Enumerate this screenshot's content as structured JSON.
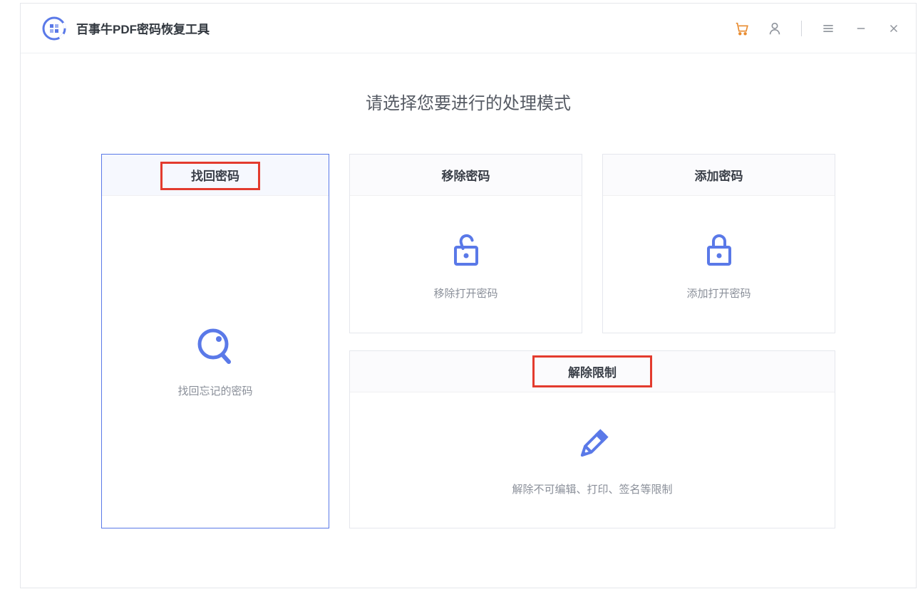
{
  "app": {
    "title": "百事牛PDF密码恢复工具"
  },
  "page": {
    "heading": "请选择您要进行的处理模式"
  },
  "cards": {
    "recover": {
      "title": "找回密码",
      "desc": "找回忘记的密码"
    },
    "remove": {
      "title": "移除密码",
      "desc": "移除打开密码"
    },
    "add": {
      "title": "添加密码",
      "desc": "添加打开密码"
    },
    "unrestrict": {
      "title": "解除限制",
      "desc": "解除不可编辑、打印、签名等限制"
    }
  },
  "colors": {
    "accent": "#5a79e8",
    "cart": "#e88b2f",
    "highlight": "#e33b2e"
  }
}
